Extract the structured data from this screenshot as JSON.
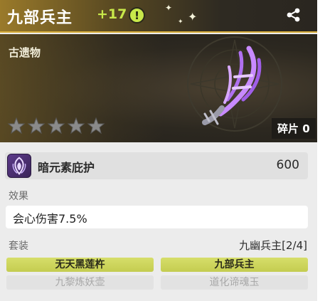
{
  "header": {
    "title": "九部兵主",
    "level": "+17",
    "info_icon": "info-icon",
    "share_icon": "share-icon"
  },
  "banner": {
    "category": "古遗物",
    "stars_filled": 0,
    "stars_total": 5,
    "fragments_label": "碎片 0"
  },
  "main_stat": {
    "icon": "dark-element-icon",
    "name": "暗元素庇护",
    "value": "600"
  },
  "effect": {
    "label": "效果",
    "text": "会心伤害7.5%"
  },
  "set": {
    "label": "套装",
    "name": "九幽兵主[2/4]",
    "items": [
      {
        "name": "无天黑莲杵",
        "active": true
      },
      {
        "name": "九部兵主",
        "active": true
      },
      {
        "name": "九黎炼妖壶",
        "active": false
      },
      {
        "name": "道化谛魂玉",
        "active": false
      }
    ]
  },
  "colors": {
    "gold_accent": "#d8ae3a",
    "level_green": "#c8e84a",
    "set_active": "#d6de6a"
  }
}
